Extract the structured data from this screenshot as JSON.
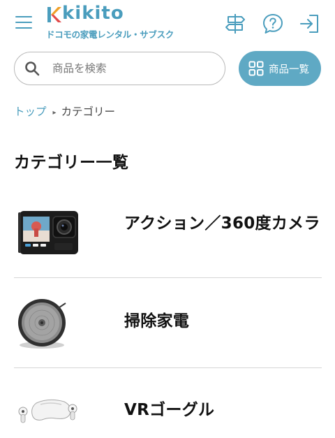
{
  "header": {
    "logo_text": "kikito",
    "logo_subtitle": "ドコモの家電レンタル・サブスク",
    "icons": [
      "menu-icon",
      "signpost-icon",
      "help-icon",
      "login-icon"
    ]
  },
  "search": {
    "placeholder": "商品を検索",
    "value": ""
  },
  "all_products_button": {
    "label": "商品一覧",
    "icon": "grid-icon"
  },
  "breadcrumb": {
    "items": [
      "トップ",
      "カテゴリー"
    ]
  },
  "page": {
    "title": "カテゴリー一覧"
  },
  "categories": [
    {
      "name": "アクション／360度カメラ",
      "thumbnail": "action-camera"
    },
    {
      "name": "掃除家電",
      "thumbnail": "robot-vacuum"
    },
    {
      "name": "VRゴーグル",
      "thumbnail": "vr-headset"
    }
  ],
  "colors": {
    "brand": "#4a9dbd",
    "button": "#5fa9c4",
    "logo_accent_orange": "#f0a028",
    "logo_accent_red": "#e24a4a",
    "divider": "#d6d6d6"
  }
}
